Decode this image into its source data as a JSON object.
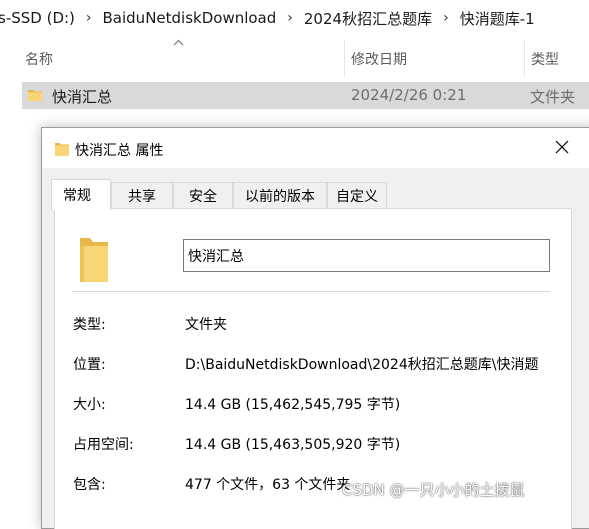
{
  "breadcrumb": {
    "items": [
      "s-SSD (D:)",
      "BaiduNetdiskDownload",
      "2024秋招汇总题库",
      "快消题库-1"
    ],
    "separator": "›"
  },
  "columns": {
    "name": "名称",
    "date": "修改日期",
    "type": "类型"
  },
  "file": {
    "name": "快消汇总",
    "date": "2024/2/26 0:21",
    "type": "文件夹"
  },
  "dialog": {
    "title": "快消汇总 属性",
    "tabs": [
      "常规",
      "共享",
      "安全",
      "以前的版本",
      "自定义"
    ],
    "active_tab": "常规",
    "name_value": "快消汇总",
    "properties": [
      {
        "label": "类型:",
        "value": "文件夹"
      },
      {
        "label": "位置:",
        "value": "D:\\BaiduNetdiskDownload\\2024秋招汇总题库\\快消题"
      },
      {
        "label": "大小:",
        "value": "14.4 GB (15,462,545,795 字节)"
      },
      {
        "label": "占用空间:",
        "value": "14.4 GB (15,463,505,920 字节)"
      },
      {
        "label": "包含:",
        "value": "477 个文件，63 个文件夹"
      }
    ]
  },
  "watermark": "CSDN @一只小小的土拨鼠",
  "colors": {
    "selection": "#d9d9d9",
    "dialog_bg": "#f0f0f0",
    "folder": "#f8d675"
  },
  "icons": {
    "folder": "folder-icon",
    "close": "close-icon",
    "sort": "sort-up-icon"
  }
}
